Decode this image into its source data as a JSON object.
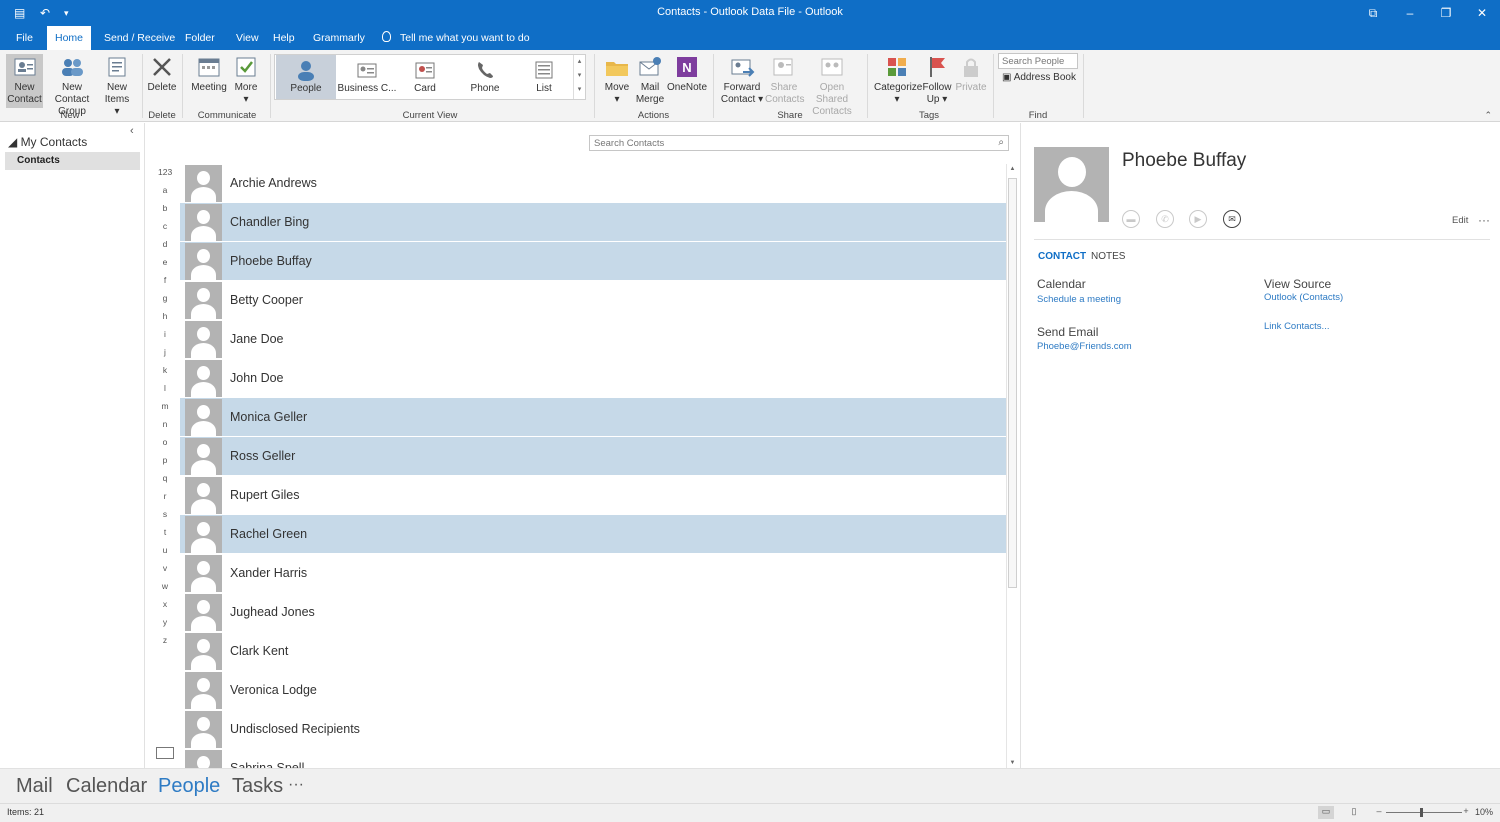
{
  "window": {
    "title": "Contacts - Outlook Data File  -  Outlook",
    "quick_access": [
      "save-icon",
      "undo-icon",
      "customize-icon"
    ],
    "controls": [
      "ribbon-display-icon",
      "minimize-icon",
      "restore-icon",
      "close-icon"
    ]
  },
  "tabs": [
    {
      "label": "File"
    },
    {
      "label": "Home"
    },
    {
      "label": "Send / Receive"
    },
    {
      "label": "Folder"
    },
    {
      "label": "View"
    },
    {
      "label": "Help"
    },
    {
      "label": "Grammarly"
    }
  ],
  "tell_me": "Tell me what you want to do",
  "ribbon": {
    "new": {
      "new_contact_1": "New",
      "new_contact_2": "Contact",
      "new_group_1": "New Contact",
      "new_group_2": "Group",
      "new_items_1": "New",
      "new_items_2": "Items",
      "group": "New"
    },
    "delete": {
      "label": "Delete",
      "group": "Delete"
    },
    "communicate": {
      "meeting": "Meeting",
      "more": "More",
      "group": "Communicate"
    },
    "current_view": {
      "items": [
        "People",
        "Business C...",
        "Card",
        "Phone",
        "List"
      ],
      "group": "Current View"
    },
    "actions": {
      "move": "Move",
      "mail_merge_1": "Mail",
      "mail_merge_2": "Merge",
      "onenote": "OneNote",
      "group": "Actions"
    },
    "share": {
      "forward_1": "Forward",
      "forward_2": "Contact",
      "share_1": "Share",
      "share_2": "Contacts",
      "open_shared_1": "Open Shared",
      "open_shared_2": "Contacts",
      "group": "Share"
    },
    "tags": {
      "categorize": "Categorize",
      "follow_up_1": "Follow",
      "follow_up_2": "Up",
      "private": "Private",
      "group": "Tags"
    },
    "find": {
      "search_placeholder": "Search People",
      "address_book": "Address Book",
      "group": "Find"
    }
  },
  "folder_pane": {
    "header": "My Contacts",
    "folder": "Contacts"
  },
  "list": {
    "search_placeholder": "Search Contacts",
    "alpha": [
      "123",
      "a",
      "b",
      "c",
      "d",
      "e",
      "f",
      "g",
      "h",
      "i",
      "j",
      "k",
      "l",
      "m",
      "n",
      "o",
      "p",
      "q",
      "r",
      "s",
      "t",
      "u",
      "v",
      "w",
      "x",
      "y",
      "z"
    ],
    "contacts": [
      {
        "name": "Archie Andrews",
        "selected": false
      },
      {
        "name": "Chandler Bing",
        "selected": true
      },
      {
        "name": "Phoebe Buffay",
        "selected": true
      },
      {
        "name": "Betty Cooper",
        "selected": false
      },
      {
        "name": "Jane Doe",
        "selected": false
      },
      {
        "name": "John Doe",
        "selected": false
      },
      {
        "name": "Monica Geller",
        "selected": true
      },
      {
        "name": "Ross Geller",
        "selected": true
      },
      {
        "name": "Rupert Giles",
        "selected": false
      },
      {
        "name": "Rachel Green",
        "selected": true
      },
      {
        "name": "Xander Harris",
        "selected": false
      },
      {
        "name": "Jughead Jones",
        "selected": false
      },
      {
        "name": "Clark Kent",
        "selected": false
      },
      {
        "name": "Veronica Lodge",
        "selected": false
      },
      {
        "name": "Undisclosed Recipients",
        "selected": false
      },
      {
        "name": "Sabrina Spell",
        "selected": false
      }
    ]
  },
  "contact_card": {
    "name": "Phoebe Buffay",
    "actions": [
      "chat-icon",
      "phone-icon",
      "video-icon",
      "email-icon"
    ],
    "edit": "Edit",
    "tabs": [
      "CONTACT",
      "NOTES"
    ],
    "calendar_label": "Calendar",
    "calendar_link": "Schedule a meeting",
    "send_email_label": "Send Email",
    "email": "Phoebe@Friends.com",
    "view_source_label": "View Source",
    "view_source_link": "Outlook (Contacts)",
    "link_contacts": "Link Contacts..."
  },
  "nav": [
    "Mail",
    "Calendar",
    "People",
    "Tasks"
  ],
  "status": {
    "items": "Items: 21",
    "zoom": "10%"
  },
  "colors": {
    "accent": "#0f6ec6",
    "selected_row": "#c6d9e8",
    "link": "#2e7bc4"
  }
}
